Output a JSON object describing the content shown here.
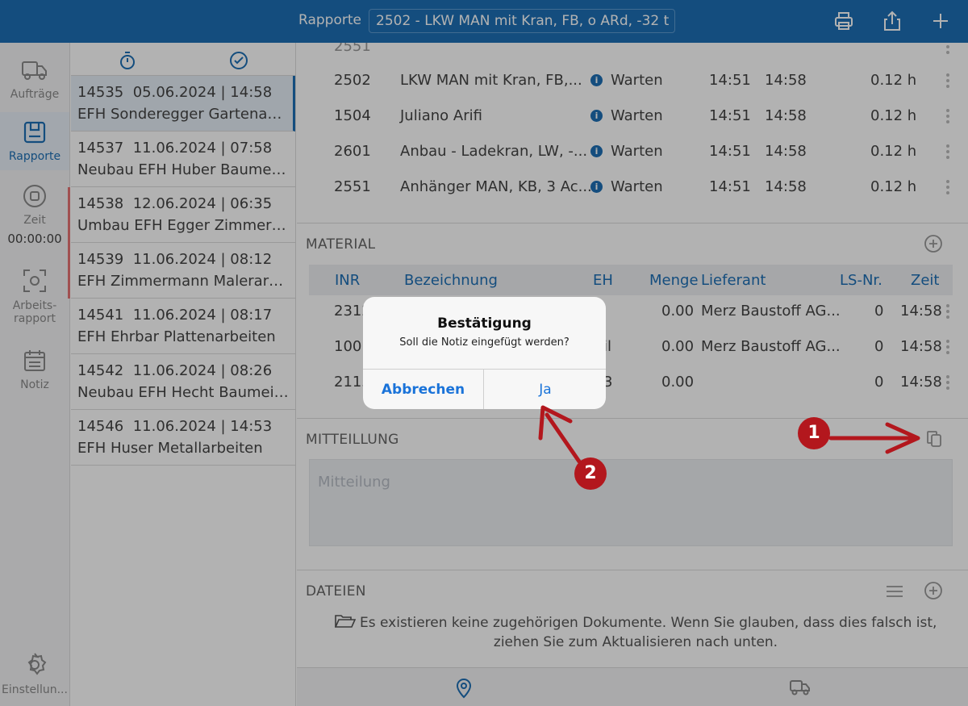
{
  "header": {
    "title": "Rapporte",
    "selected_report": "2502 - LKW MAN mit Kran, FB, o ARd, -32 t"
  },
  "rail": {
    "items": [
      {
        "label": "Aufträge",
        "icon": "truck-icon"
      },
      {
        "label": "Rapporte",
        "icon": "report-icon"
      },
      {
        "label": "Zeit",
        "icon": "stop-circle-icon",
        "timer": "00:00:00"
      },
      {
        "label_line1": "Arbeits-",
        "label_line2": "rapport",
        "icon": "scan-icon"
      },
      {
        "label": "Notiz",
        "icon": "calendar-icon"
      },
      {
        "label": "Einstellun...",
        "icon": "gear-icon"
      }
    ]
  },
  "reports": [
    {
      "number": "14535",
      "datetime": "05.06.2024 | 14:58",
      "title": "EFH Sonderegger Gartenarb..."
    },
    {
      "number": "14537",
      "datetime": "11.06.2024 | 07:58",
      "title": "Neubau EFH Huber Baumeist..."
    },
    {
      "number": "14538",
      "datetime": "12.06.2024 | 06:35",
      "title": "Umbau EFH Egger Zimmerar..."
    },
    {
      "number": "14539",
      "datetime": "11.06.2024 | 08:12",
      "title": "EFH Zimmermann Malerarbe..."
    },
    {
      "number": "14541",
      "datetime": "11.06.2024 | 08:17",
      "title": "EFH Ehrbar Plattenarbeiten"
    },
    {
      "number": "14542",
      "datetime": "11.06.2024 | 08:26",
      "title": "Neubau EFH Hecht Baumeist..."
    },
    {
      "number": "14546",
      "datetime": "11.06.2024 | 14:53",
      "title": "EFH Huser Metallarbeiten"
    }
  ],
  "resources": [
    {
      "id": "2502",
      "name": "LKW MAN mit Kran, FB,...",
      "status": "Warten",
      "from": "14:51",
      "to": "14:58",
      "hours": "0.12 h"
    },
    {
      "id": "1504",
      "name": "Juliano Arifi",
      "status": "Warten",
      "from": "14:51",
      "to": "14:58",
      "hours": "0.12 h"
    },
    {
      "id": "2601",
      "name": "Anbau - Ladekran, LW, -...",
      "status": "Warten",
      "from": "14:51",
      "to": "14:58",
      "hours": "0.12 h"
    },
    {
      "id": "2551",
      "name": "Anhänger MAN, KB, 3 Ac...",
      "status": "Warten",
      "from": "14:51",
      "to": "14:58",
      "hours": "0.12 h"
    }
  ],
  "material": {
    "title": "MATERIAL",
    "columns": {
      "inr": "INR",
      "bezeichnung": "Bezeichnung",
      "eh": "EH",
      "menge": "Menge",
      "lieferant": "Lieferant",
      "ls": "LS-Nr.",
      "zeit": "Zeit"
    },
    "rows": [
      {
        "inr": "2312",
        "menge": "0.00",
        "lieferant": "Merz Baustoff AG...",
        "ls": "0",
        "zeit": "14:58"
      },
      {
        "inr": "1001",
        "eh_fragment": "il",
        "menge": "0.00",
        "lieferant": "Merz Baustoff AG...",
        "ls": "0",
        "zeit": "14:58"
      },
      {
        "inr": "2113.",
        "eh_fragment": "3",
        "menge": "0.00",
        "lieferant": "",
        "ls": "0",
        "zeit": "14:58"
      }
    ]
  },
  "mitteilung": {
    "title": "MITTEILLUNG",
    "placeholder": "Mitteilung"
  },
  "dateien": {
    "title": "DATEIEN",
    "empty_message": "Es existieren keine zugehörigen Dokumente. Wenn Sie glauben, dass dies falsch ist, ziehen Sie zum Aktualisieren nach unten."
  },
  "dialog": {
    "title": "Bestätigung",
    "message": "Soll die Notiz eingefügt werden?",
    "cancel": "Abbrechen",
    "confirm": "Ja"
  },
  "callouts": {
    "one": "1",
    "two": "2"
  },
  "colors": {
    "brand": "#1d6fb5",
    "callout": "#b3171d",
    "dialog_button": "#1a73d9"
  }
}
